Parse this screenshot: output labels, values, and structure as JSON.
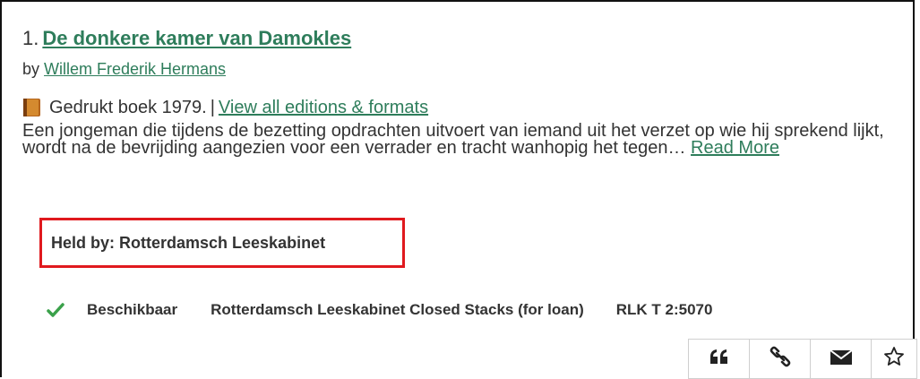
{
  "result": {
    "number": "1.",
    "title": "De donkere kamer van Damokles",
    "by_prefix": "by",
    "author": "Willem Frederik Hermans",
    "format": "Gedrukt boek",
    "year": "1979.",
    "separator": "|",
    "editions_link": "View all editions & formats",
    "summary": "Een jongeman die tijdens de bezetting opdrachten uitvoert van iemand uit het verzet op wie hij sprekend lijkt, wordt na de bevrijding aangezien voor een verrader en tracht wanhopig het tegen…",
    "read_more": "Read More",
    "held_by": "Held by: Rotterdamsch Leeskabinet",
    "holding": {
      "status": "Beschikbaar",
      "location": "Rotterdamsch Leeskabinet Closed Stacks (for loan)",
      "call_number": "RLK T 2:5070"
    }
  },
  "colors": {
    "link": "#2e7d5b",
    "highlight_border": "#e0191e",
    "check": "#3aa14a"
  },
  "actions": [
    {
      "name": "cite-button",
      "icon": "quote-icon"
    },
    {
      "name": "permalink-button",
      "icon": "link-icon"
    },
    {
      "name": "email-button",
      "icon": "envelope-icon"
    },
    {
      "name": "favorite-button",
      "icon": "star-icon"
    }
  ]
}
